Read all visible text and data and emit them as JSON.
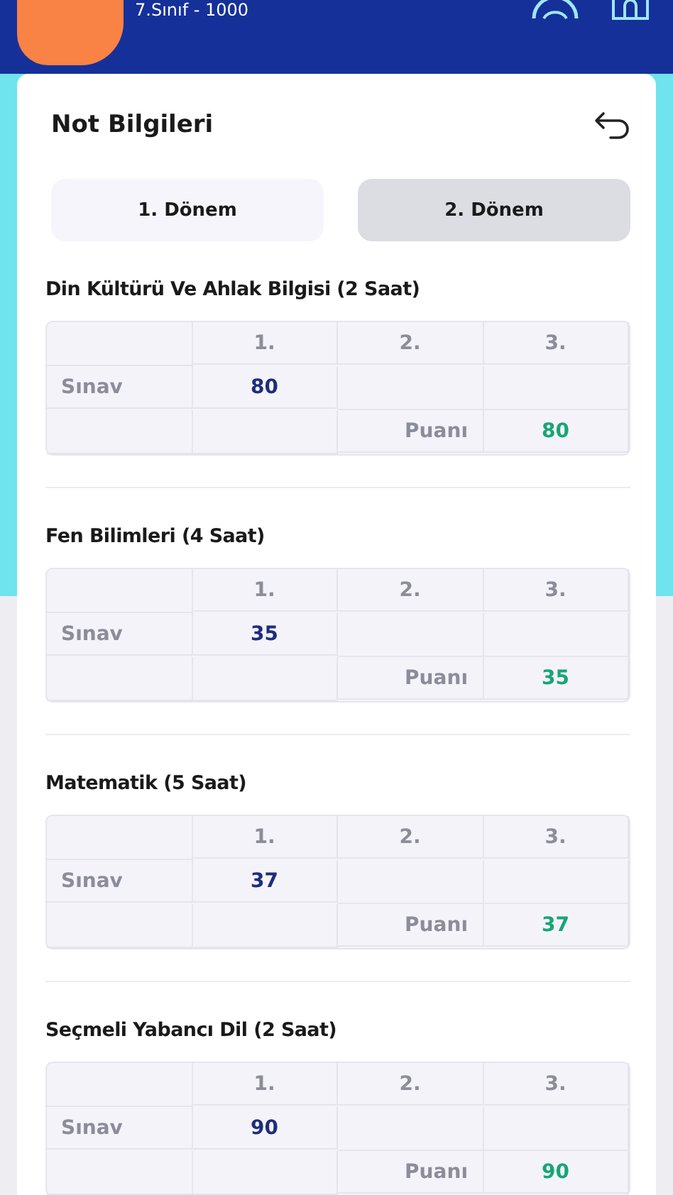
{
  "header": {
    "subtitle": "7.Sınıf - 1000"
  },
  "card": {
    "title": "Not Bilgileri"
  },
  "tabs": [
    {
      "label": "1. Dönem",
      "selected": false
    },
    {
      "label": "2. Dönem",
      "selected": true
    }
  ],
  "courses": [
    {
      "name": "Din Kültürü Ve Ahlak Bilgisi (2 Saat)",
      "columns": [
        "1.",
        "2.",
        "3."
      ],
      "row_label": "Sınav",
      "scores": [
        "80"
      ],
      "score_label": "Puanı",
      "score": "80"
    },
    {
      "name": "Fen Bilimleri (4 Saat)",
      "columns": [
        "1.",
        "2.",
        "3."
      ],
      "row_label": "Sınav",
      "scores": [
        "35"
      ],
      "score_label": "Puanı",
      "score": "35"
    },
    {
      "name": "Matematik (5 Saat)",
      "columns": [
        "1.",
        "2.",
        "3."
      ],
      "row_label": "Sınav",
      "scores": [
        "37"
      ],
      "score_label": "Puanı",
      "score": "37"
    },
    {
      "name": "Seçmeli Yabancı Dil (2 Saat)",
      "columns": [
        "1.",
        "2.",
        "3."
      ],
      "row_label": "Sınav",
      "scores": [
        "90"
      ],
      "score_label": "Puanı",
      "score": "90"
    }
  ]
}
